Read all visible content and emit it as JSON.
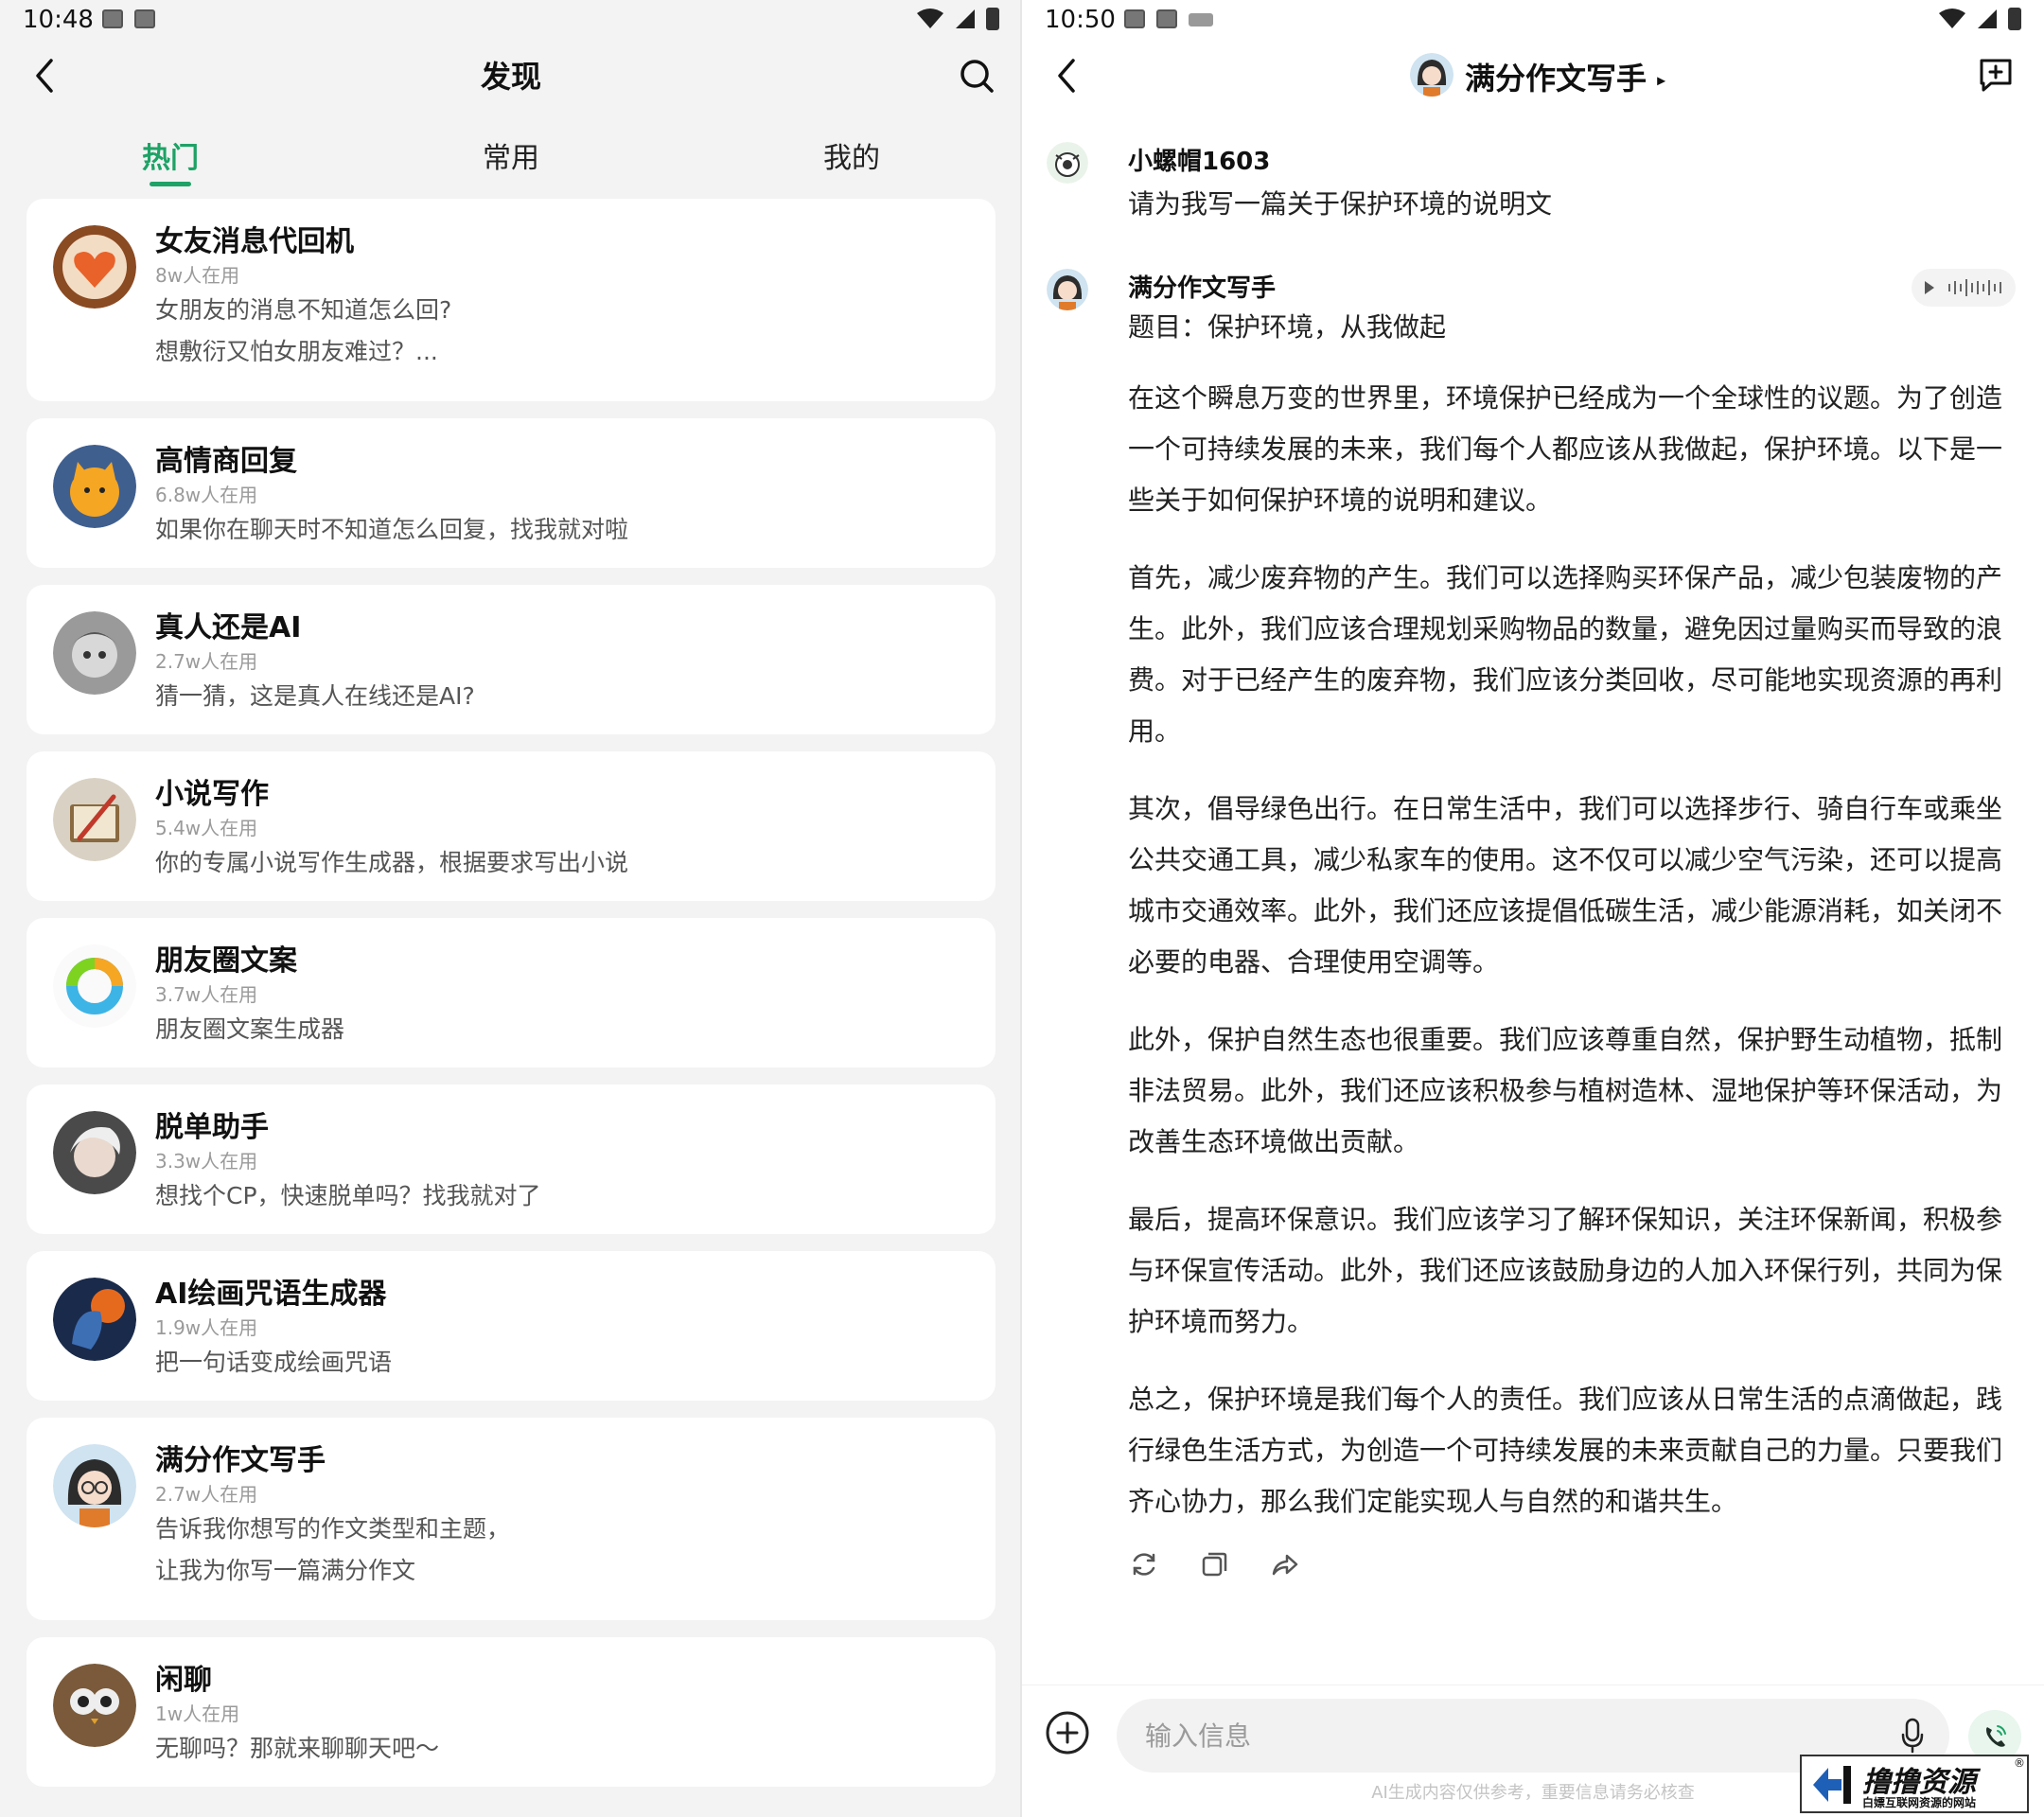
{
  "left": {
    "status_time": "10:48",
    "title": "发现",
    "tabs": [
      {
        "label": "热门"
      },
      {
        "label": "常用"
      },
      {
        "label": "我的"
      }
    ],
    "cards": [
      {
        "title": "女友消息代回机",
        "users": "8w人在用",
        "desc": "女朋友的消息不知道怎么回?\n想敷衍又怕女朋友难过？..."
      },
      {
        "title": "高情商回复",
        "users": "6.8w人在用",
        "desc": "如果你在聊天时不知道怎么回复，找我就对啦"
      },
      {
        "title": "真人还是AI",
        "users": "2.7w人在用",
        "desc": "猜一猜，这是真人在线还是AI?"
      },
      {
        "title": "小说写作",
        "users": "5.4w人在用",
        "desc": "你的专属小说写作生成器，根据要求写出小说"
      },
      {
        "title": "朋友圈文案",
        "users": "3.7w人在用",
        "desc": "朋友圈文案生成器"
      },
      {
        "title": "脱单助手",
        "users": "3.3w人在用",
        "desc": "想找个CP，快速脱单吗？找我就对了"
      },
      {
        "title": "AI绘画咒语生成器",
        "users": "1.9w人在用",
        "desc": "把一句话变成绘画咒语"
      },
      {
        "title": "满分作文写手",
        "users": "2.7w人在用",
        "desc": "告诉我你想写的作文类型和主题，\n让我为你写一篇满分作文"
      },
      {
        "title": "闲聊",
        "users": "1w人在用",
        "desc": "无聊吗？那就来聊聊天吧～"
      }
    ]
  },
  "right": {
    "status_time": "10:50",
    "title": "满分作文写手",
    "user": {
      "name": "小螺帽1603",
      "message": "请为我写一篇关于保护环境的说明文"
    },
    "bot": {
      "name": "满分作文写手",
      "subject": "题目：保护环境，从我做起",
      "paragraphs": [
        "在这个瞬息万变的世界里，环境保护已经成为一个全球性的议题。为了创造一个可持续发展的未来，我们每个人都应该从我做起，保护环境。以下是一些关于如何保护环境的说明和建议。",
        "首先，减少废弃物的产生。我们可以选择购买环保产品，减少包装废物的产生。此外，我们应该合理规划采购物品的数量，避免因过量购买而导致的浪费。对于已经产生的废弃物，我们应该分类回收，尽可能地实现资源的再利用。",
        "其次，倡导绿色出行。在日常生活中，我们可以选择步行、骑自行车或乘坐公共交通工具，减少私家车的使用。这不仅可以减少空气污染，还可以提高城市交通效率。此外，我们还应该提倡低碳生活，减少能源消耗，如关闭不必要的电器、合理使用空调等。",
        "此外，保护自然生态也很重要。我们应该尊重自然，保护野生动植物，抵制非法贸易。此外，我们还应该积极参与植树造林、湿地保护等环保活动，为改善生态环境做出贡献。",
        "最后，提高环保意识。我们应该学习了解环保知识，关注环保新闻，积极参与环保宣传活动。此外，我们还应该鼓励身边的人加入环保行列，共同为保护环境而努力。",
        "总之，保护环境是我们每个人的责任。我们应该从日常生活的点滴做起，践行绿色生活方式，为创造一个可持续发展的未来贡献自己的力量。只要我们齐心协力，那么我们定能实现人与自然的和谐共生。"
      ]
    },
    "input_placeholder": "输入信息",
    "disclaimer": "AI生成内容仅供参考，重要信息请务必核查"
  },
  "watermark": {
    "main": "撸撸资源",
    "sub": "白嫖互联网资源的网站",
    "reg": "®"
  },
  "colors": {
    "accent": "#1ea266",
    "card_bg": "#ffffff",
    "page_bg": "#f3f3f3"
  }
}
